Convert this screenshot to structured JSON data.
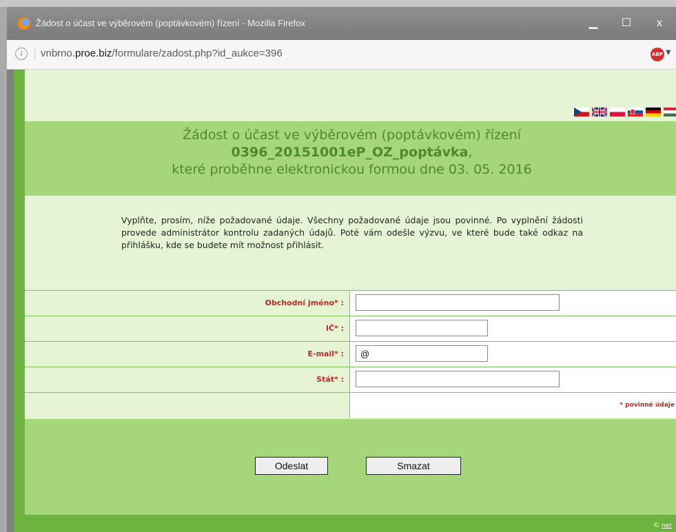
{
  "browser": {
    "title": "Žádost o účast ve výběrovém (poptávkovém) řízení - Mozilla Firefox",
    "url_prefix": "vnbrno.",
    "url_domain": "proe.biz",
    "url_path": "/formulare/zadost.php?id_aukce=396",
    "minimize": "▁",
    "maximize": "☐",
    "close": "x",
    "abp_label": "ABP"
  },
  "flags": [
    "cz-flag",
    "gb-flag",
    "pl-flag",
    "sk-flag",
    "de-flag",
    "hu-flag"
  ],
  "header": {
    "line1": "Žádost o účast ve výběrovém (poptávkovém) řízení",
    "line2": "0396_20151001eP_OZ_poptávka",
    "line2_suffix": ",",
    "line3": "které proběhne elektronickou formou dne 03. 05. 2016"
  },
  "intro": "Vyplňte, prosím, níže požadované údaje. Všechny požadované údaje jsou povinné. Po vyplnění žádosti provede administrátor kontrolu zadaných údajů. Poté vám odešle výzvu, ve které bude také odkaz na přihlášku, kde se budete mít možnost přihlásit.",
  "form": {
    "company_label": "Obchodní jméno* :",
    "ic_label": "IČ* :",
    "email_label": "E-mail* :",
    "email_value": "@",
    "country_label": "Stát* :",
    "required_note": "* povinné údaje"
  },
  "buttons": {
    "submit": "Odeslat",
    "reset": "Smazat"
  },
  "footer": {
    "copyright": "©",
    "link": "ner"
  },
  "colors": {
    "page_bg": "#e6f4d6",
    "header_bg": "#a6d67c",
    "frame_green": "#6db33f",
    "label_red": "#c0282a"
  }
}
